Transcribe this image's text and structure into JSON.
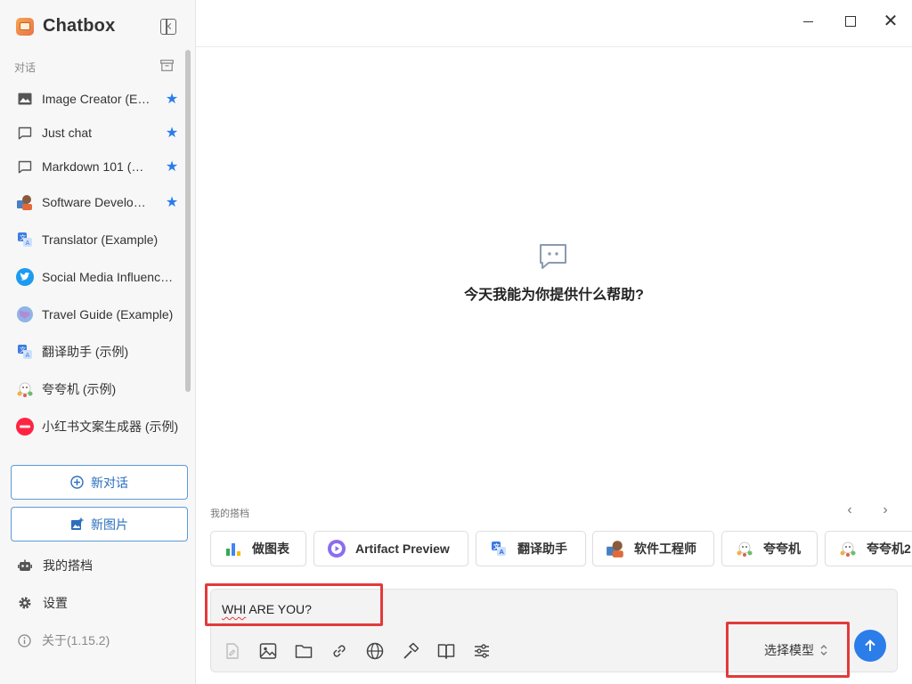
{
  "app": {
    "name": "Chatbox",
    "version_label": "关于(1.15.2)"
  },
  "sidebar": {
    "section_label": "对话",
    "conversations": [
      {
        "label": "Image Creator (E…",
        "icon": "image-icon",
        "starred": true
      },
      {
        "label": "Just chat",
        "icon": "chat-bubble-icon",
        "starred": true
      },
      {
        "label": "Markdown 101 (…",
        "icon": "chat-bubble-icon",
        "starred": true
      },
      {
        "label": "Software Develo…",
        "icon": "developer-avatar-icon",
        "starred": true
      },
      {
        "label": "Translator (Example)",
        "icon": "translate-icon",
        "starred": false
      },
      {
        "label": "Social Media Influenc…",
        "icon": "twitter-bird-icon",
        "starred": false
      },
      {
        "label": "Travel Guide (Example)",
        "icon": "globe-icon",
        "starred": false
      },
      {
        "label": "翻译助手 (示例)",
        "icon": "translate-icon",
        "starred": false
      },
      {
        "label": "夸夸机 (示例)",
        "icon": "cheer-mascot-icon",
        "starred": false
      },
      {
        "label": "小红书文案生成器 (示例)",
        "icon": "xiaohongshu-logo-icon",
        "starred": false
      }
    ],
    "new_chat_label": "新对话",
    "new_image_label": "新图片",
    "my_copilots_label": "我的搭档",
    "settings_label": "设置"
  },
  "main": {
    "empty_prompt": "今天我能为你提供什么帮助?"
  },
  "copilots": {
    "label": "我的搭档",
    "items": [
      {
        "label": "做图表",
        "icon": "bar-chart-icon"
      },
      {
        "label": "Artifact Preview",
        "icon": "play-circle-icon"
      },
      {
        "label": "翻译助手",
        "icon": "translate-icon"
      },
      {
        "label": "软件工程师",
        "icon": "developer-avatar-icon"
      },
      {
        "label": "夸夸机",
        "icon": "cheer-mascot-icon"
      },
      {
        "label": "夸夸机2",
        "icon": "cheer-mascot-icon"
      }
    ]
  },
  "input": {
    "value_misspelled": "WHI",
    "value_rest": " ARE YOU?",
    "model_select_label": "选择模型"
  },
  "colors": {
    "accent": "#2b7de9",
    "highlight": "#e23a3a",
    "sidebar_bg": "#f7f7f8"
  }
}
